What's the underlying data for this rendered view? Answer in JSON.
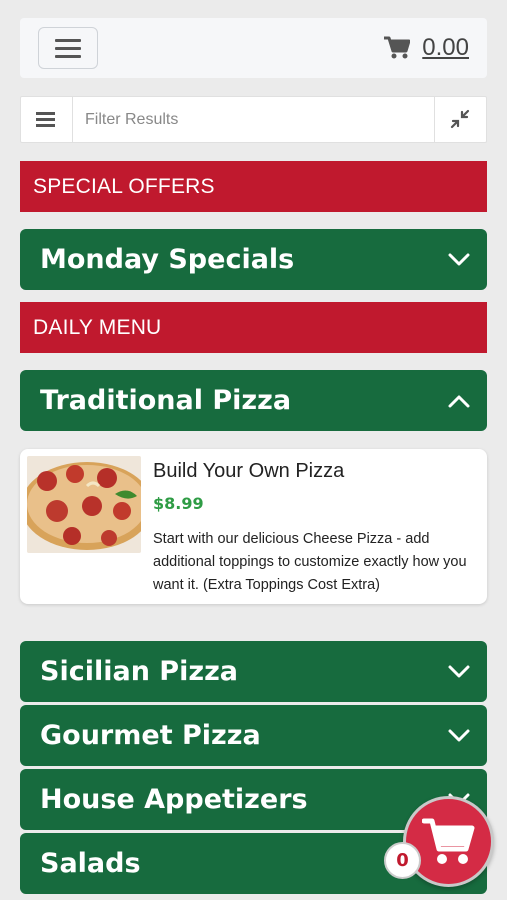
{
  "header": {
    "cart_total": "0.00",
    "menu_icon": "hamburger-icon",
    "cart_icon": "cart-icon"
  },
  "filter": {
    "placeholder": "Filter Results",
    "list_icon": "list-icon",
    "collapse_icon": "collapse-arrows-icon"
  },
  "sections": {
    "special_offers": "SPECIAL OFFERS",
    "daily_menu": "DAILY MENU"
  },
  "categories": {
    "monday_specials": "Monday Specials",
    "traditional_pizza": "Traditional Pizza",
    "sicilian_pizza": "Sicilian Pizza",
    "gourmet_pizza": "Gourmet Pizza",
    "house_appetizers": "House Appetizers",
    "salads": "Salads"
  },
  "item": {
    "name": "Build Your Own Pizza",
    "price": "$8.99",
    "description": "Start with our delicious Cheese Pizza - add additional toppings to customize exactly how you want it. (Extra Toppings Cost Extra)"
  },
  "floating_cart": {
    "count": "0"
  },
  "colors": {
    "red": "#c0192e",
    "green": "#176b3e",
    "price_green": "#2f9c45",
    "background": "#ebebeb"
  }
}
